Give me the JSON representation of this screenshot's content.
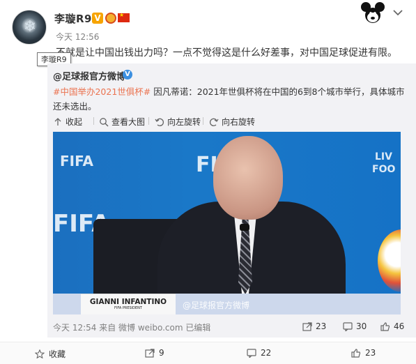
{
  "header": {
    "username": "李璇R9",
    "time": "今天 12:56",
    "post_text": "不就是让中国出钱出力吗？一点不觉得这是什么好差事，对中国足球促进有限。",
    "tooltip": "李璇R9",
    "vip_badge": "V"
  },
  "repost": {
    "author": "@足球报官方微博",
    "hashtag": "#中国举办2021世俱杯#",
    "text": " 因凡蒂诺：2021年世俱杯将在中国的6到8个城市举行，具体城市还未选出。",
    "tools": {
      "collapse": "收起",
      "view_large": "查看大图",
      "rotate_left": "向左旋转",
      "rotate_right": "向右旋转"
    },
    "photo": {
      "nameplate_name": "GIANNI INFANTINO",
      "nameplate_title": "FIFA PRESIDENT",
      "watermark": "@足球报官方微博",
      "backdrop_fifa": "FIFA",
      "backdrop_live": "LIV",
      "backdrop_foo": "FOO"
    },
    "meta": "今天 12:54 来自 微博 weibo.com  已编辑",
    "actions": {
      "repost": "23",
      "comment": "30",
      "like": "46"
    }
  },
  "footer": {
    "favorite": "收藏",
    "repost": "9",
    "comment": "22",
    "like": "23"
  },
  "colors": {
    "hashtag": "#eb7350",
    "verified": "#3b8fe0",
    "vip": "#f7a400"
  },
  "icons": [
    "collapse-arrow-icon",
    "magnifier-icon",
    "rotate-left-icon",
    "rotate-right-icon",
    "share-icon",
    "comment-icon",
    "thumbs-up-icon",
    "star-icon",
    "chevron-down-icon",
    "mickey-mascot-icon"
  ]
}
